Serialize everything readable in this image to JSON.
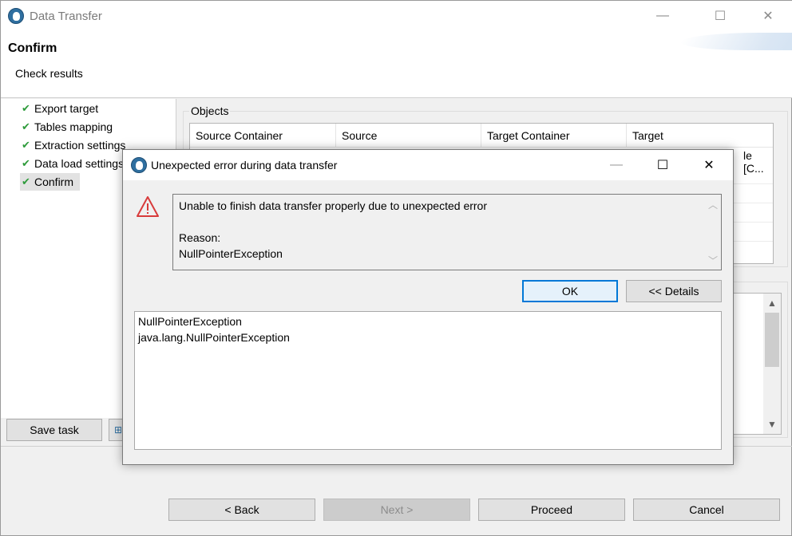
{
  "window": {
    "title": "Data Transfer",
    "minimize_glyph": "—",
    "maximize_glyph": "☐",
    "close_glyph": "✕"
  },
  "header": {
    "title": "Confirm",
    "subtitle": "Check results"
  },
  "steps": [
    {
      "label": "Export target",
      "check": "✔"
    },
    {
      "label": "Tables mapping",
      "check": "✔"
    },
    {
      "label": "Extraction settings",
      "check": "✔"
    },
    {
      "label": "Data load settings",
      "check": "✔"
    },
    {
      "label": "Confirm",
      "check": "✔",
      "selected": true
    }
  ],
  "left_buttons": {
    "save_task": "Save task"
  },
  "objects": {
    "group_label": "Objects",
    "columns": [
      "Source Container",
      "Source",
      "Target Container",
      "Target"
    ],
    "visible_fragment": "le [C..."
  },
  "dialog": {
    "title": "Unexpected error during data transfer",
    "minimize_glyph": "—",
    "maximize_glyph": "☐",
    "close_glyph": "✕",
    "message_line1": "Unable to finish data transfer properly due to unexpected error",
    "reason_label": "Reason:",
    "reason_value": "NullPointerException",
    "ok_label": "OK",
    "details_label": "<< Details",
    "details_lines": [
      "NullPointerException",
      "java.lang.NullPointerException"
    ]
  },
  "footer": {
    "back_label": "< Back",
    "next_label": "Next >",
    "proceed_label": "Proceed",
    "cancel_label": "Cancel"
  },
  "colors": {
    "accent": "#0078d7",
    "check_green": "#2e9b3b",
    "warning_red": "#d83b3b"
  }
}
